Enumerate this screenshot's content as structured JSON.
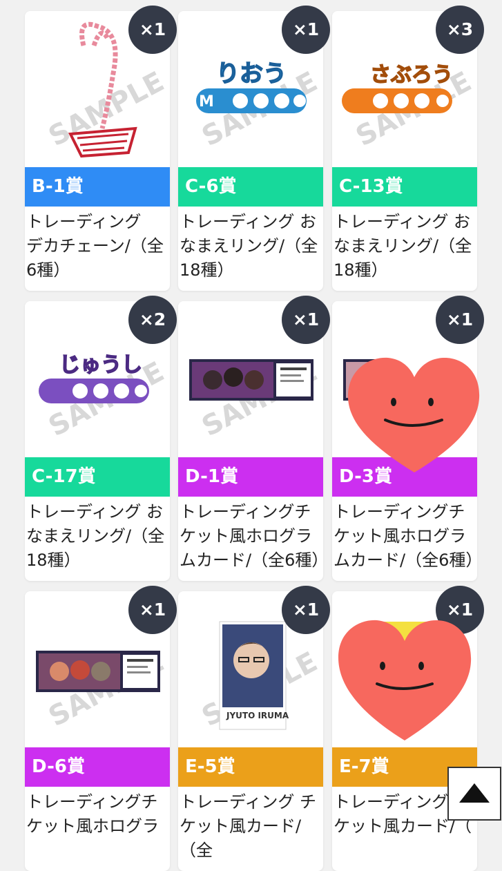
{
  "colors": {
    "blue": "#2f8cf5",
    "green": "#17d99b",
    "purple": "#cc2ff0",
    "orange": "#eba01a",
    "badge": "#343a48",
    "heart": "#f7685e"
  },
  "watermark": "SAMPLE",
  "cards": [
    {
      "code": "B-1賞",
      "qty": "×1",
      "title": "トレーディング\nデカチェーン/（全\n6種）"
    },
    {
      "code": "C-6賞",
      "qty": "×1",
      "title": "トレーディング お\nなまえリング/（全\n18種）",
      "art_text": "りおう"
    },
    {
      "code": "C-13賞",
      "qty": "×3",
      "title": "トレーディング お\nなまえリング/（全\n18種）",
      "art_text": "さぶろう"
    },
    {
      "code": "C-17賞",
      "qty": "×2",
      "title": "トレーディング お\nなまえリング/（全\n18種）",
      "art_text": "じゅうし"
    },
    {
      "code": "D-1賞",
      "qty": "×1",
      "title": "トレーディングチ\nケット風ホログラ\nムカード/（全6種）"
    },
    {
      "code": "D-3賞",
      "qty": "×1",
      "title": "トレーディングチ\nケット風ホログラ\nムカード/（全6種）"
    },
    {
      "code": "D-6賞",
      "qty": "×1",
      "title": "トレーディングチ\nケット風ホログラ"
    },
    {
      "code": "E-5賞",
      "qty": "×1",
      "title": "トレーディング チ\nケット風カード/（全",
      "art_text": "JYUTO IRUMA"
    },
    {
      "code": "E-7賞",
      "qty": "×1",
      "title": "トレーディング\nケット風カード/（"
    }
  ]
}
